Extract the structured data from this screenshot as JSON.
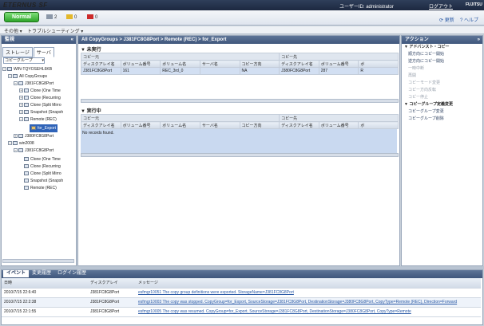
{
  "header": {
    "logo": "ETERNUS SF",
    "user": "ユーザーID: administrator",
    "logout": "ログアウト",
    "vendor": "FUJITSU"
  },
  "status": {
    "normal": "Normal",
    "c1": "2",
    "c2": "0",
    "c3": "0",
    "refresh": "更新",
    "help": "ヘルプ"
  },
  "menu": {
    "m1": "その他",
    "m2": "トラブルシューティング"
  },
  "left": {
    "title": "監視",
    "tab1": "ストレージ",
    "tab2": "サーバ",
    "select": "コピーグループ",
    "tree": [
      "WIN-TQYOSEHL6KB",
      "All CopyGroups",
      "J381FC8G8Port",
      "Clone (One Time",
      "Clone (Recurring",
      "Clone (Split Mirro",
      "Snapshot (Snapsh",
      "Remote (REC)",
      "for_Export",
      "J380FC8G8Port",
      "win2008",
      "J381FC8G8Port",
      "Clone (One Time",
      "Clone (Recurring",
      "Clone (Split Mirro",
      "Snapshot (Snapsh",
      "Remote (REC)"
    ]
  },
  "center": {
    "breadcrumb": "All CopyGroups > J381FC8G8Port > Remote (REC) > for_Export",
    "sec1": "未実行",
    "sec2": "実行中",
    "grp_src": "コピー元",
    "grp_dst": "コピー先",
    "cols": [
      "ディスクアレイ名",
      "ボリューム番号",
      "ボリューム名",
      "サーバ名",
      "コピー方向",
      "ディスクアレイ名",
      "ボリューム番号",
      "ボ"
    ],
    "row": [
      "J381FC8G8Port",
      "161",
      "REC_3rd_0",
      "",
      "NA",
      "J380FC8G8Port",
      "287",
      "R"
    ],
    "norec": "No records found."
  },
  "right": {
    "title": "アクション",
    "h1": "アドバンスト・コピー",
    "items1": [
      "順方向にコピー開始",
      "逆方向にコピー開始",
      "一時中断",
      "再開",
      "コピーモード変更",
      "コピー方向反転",
      "コピー停止"
    ],
    "h2": "コピーグループ定義変更",
    "items2": [
      "コピーグループ変更",
      "コピーグループ削除"
    ]
  },
  "bottom": {
    "tabs": [
      "イベント",
      "変更履歴",
      "ログイン履歴"
    ],
    "cols": [
      "日時",
      "ディスクアレイ",
      "メッセージ"
    ],
    "rows": [
      [
        "2010/7/15 22:6:40",
        "J381FC8G8Port",
        "esfmgr10051 The copy group definitions were exported. StorageName=J381FC8G8Port"
      ],
      [
        "2010/7/15 22:2:38",
        "J381FC8G8Port",
        "esfmgr10003 The copy was stopped. CopyGroup=for_Export, SourceStorage=J381FC8G8Port, DestinationStorage=J380FC8G8Port, CopyType=Remote (REC), Direction=Forward"
      ],
      [
        "2010/7/15 22:1:55",
        "J381FC8G8Port",
        "esfmgr10005 The copy was resumed. CopyGroup=for_Export, SourceStorage=J381FC8G8Port, DestinationStorage=J380FC8G8Port, CopyType=Remote"
      ]
    ]
  },
  "colors": {
    "accent": "#3f577c",
    "ok": "#2ea52a"
  }
}
